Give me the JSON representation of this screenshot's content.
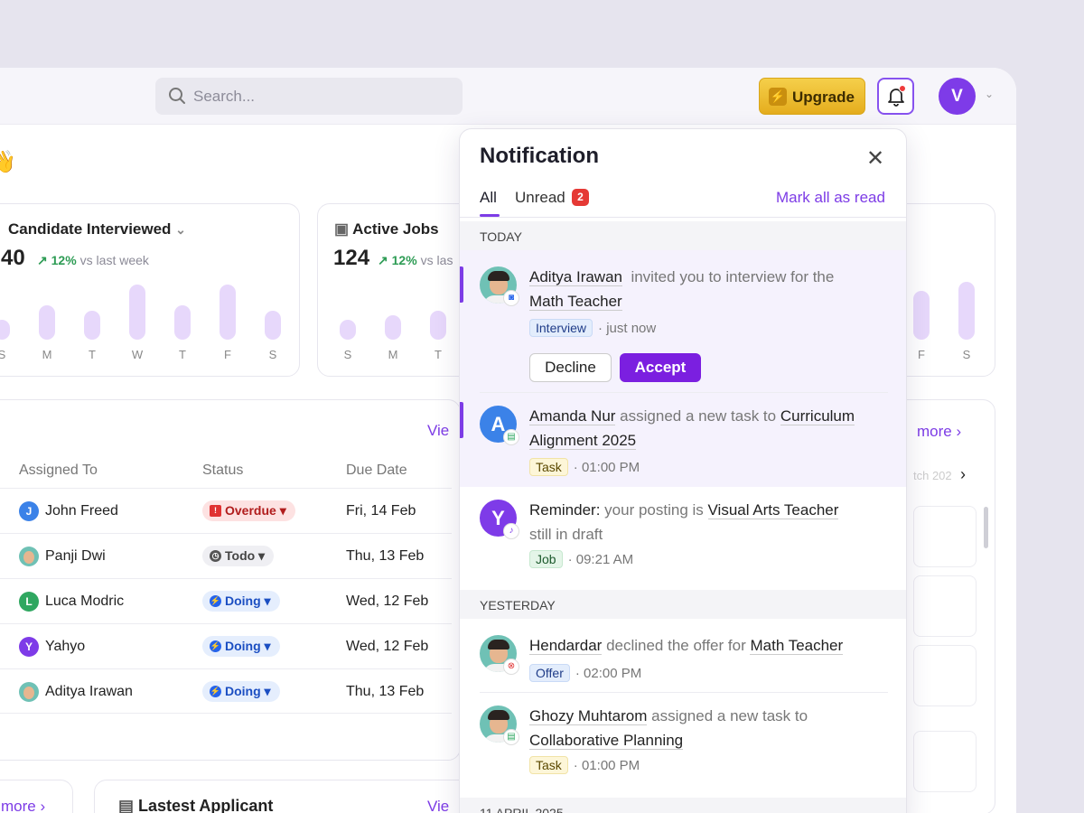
{
  "topbar": {
    "search_placeholder": "Search...",
    "upgrade_label": "Upgrade",
    "avatar_letter": "V"
  },
  "greeting_emoji": "👋",
  "stats": [
    {
      "title": "Candidate Interviewed",
      "value": "40",
      "trend": "12%",
      "trend_suffix": "vs last week",
      "days": [
        "S",
        "M",
        "T",
        "W",
        "T",
        "F",
        "S"
      ],
      "levels": [
        0.35,
        0.6,
        0.5,
        0.95,
        0.6,
        0.95,
        0.5
      ]
    },
    {
      "title": "Active Jobs",
      "value": "124",
      "trend": "12%",
      "trend_suffix": "vs las",
      "days": [
        "S",
        "M",
        "T"
      ],
      "levels": [
        0.35,
        0.42,
        0.5
      ]
    },
    {
      "days": [
        "F",
        "S"
      ],
      "levels": [
        0.85,
        1.0
      ]
    }
  ],
  "tasks": {
    "view_link": "Vie",
    "more_link": "more",
    "columns": [
      "Assigned To",
      "Status",
      "Due Date"
    ],
    "rows": [
      {
        "name": "John Freed",
        "initial": "J",
        "status": "Overdue",
        "due": "Fri, 14 Feb"
      },
      {
        "name": "Panji Dwi",
        "initial": "",
        "status": "Todo",
        "due": "Thu, 13 Feb"
      },
      {
        "name": "Luca Modric",
        "initial": "L",
        "status": "Doing",
        "due": "Wed, 12 Feb"
      },
      {
        "name": "Yahyo",
        "initial": "Y",
        "status": "Doing",
        "due": "Wed, 12 Feb"
      },
      {
        "name": "Aditya Irawan",
        "initial": "",
        "status": "Doing",
        "due": "Thu, 13 Feb"
      }
    ],
    "colors": {
      "overdue": "#fde2e2",
      "todo": "#efeff3",
      "doing": "#e5eefd"
    }
  },
  "right_side": {
    "more_link": "more",
    "date_fragment": "tch 202"
  },
  "bottom": {
    "more_link": "more",
    "latest_title": "Lastest Applicant",
    "view_link": "Vie"
  },
  "notification": {
    "title": "Notification",
    "tabs": {
      "all": "All",
      "unread": "Unread",
      "unread_count": "2",
      "mark_all": "Mark all as read"
    },
    "sections": {
      "today": "TODAY",
      "yesterday": "YESTERDAY",
      "older": "11 APRIL 2025"
    },
    "items": [
      {
        "name": "Aditya Irawan",
        "action": "invited you to interview for the",
        "target": "Math Teacher",
        "tag": "Interview",
        "time": "just now",
        "decline": "Decline",
        "accept": "Accept"
      },
      {
        "name": "Amanda Nur",
        "action": "assigned a new task to",
        "target": "Curriculum Alignment 2025",
        "tag": "Task",
        "time": "01:00 PM",
        "letter": "A"
      },
      {
        "name": "Reminder:",
        "action": "your posting is",
        "target": "Visual Arts Teacher",
        "trail": "still in draft",
        "tag": "Job",
        "time": "09:21 AM",
        "letter": "Y"
      },
      {
        "name": "Hendardar",
        "action": "declined the offer for",
        "target": "Math Teacher",
        "tag": "Offer",
        "time": "02:00 PM"
      },
      {
        "name": "Ghozy Muhtarom",
        "action": "assigned a new task to",
        "target": "Collaborative Planning",
        "tag": "Task",
        "time": "01:00 PM"
      }
    ]
  },
  "accent": "#7d3ce6"
}
